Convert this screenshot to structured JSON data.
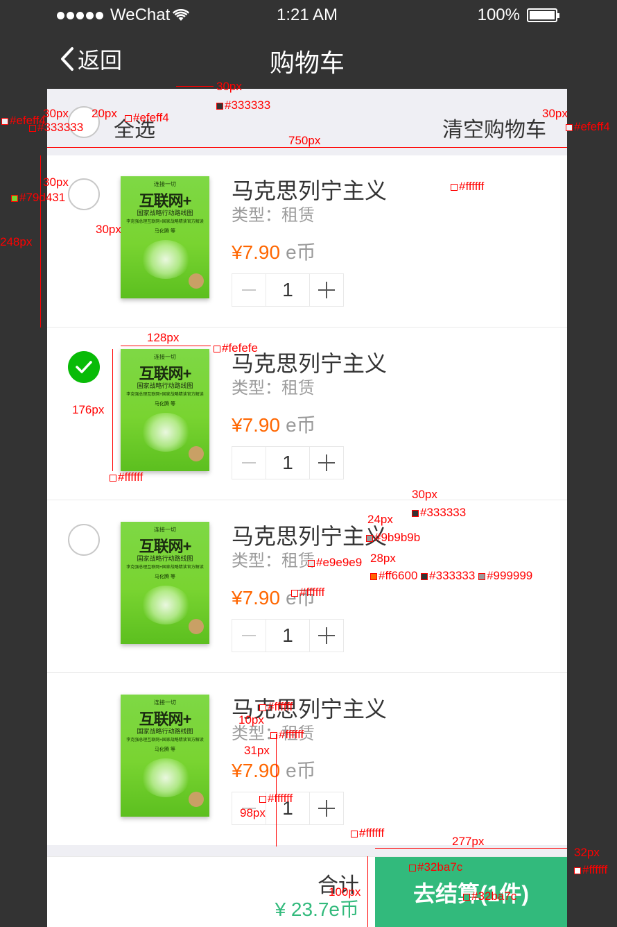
{
  "status_bar": {
    "carrier": "WeChat",
    "time": "1:21 AM",
    "battery": "100%"
  },
  "nav": {
    "back_label": "返回",
    "title": "购物车"
  },
  "select_bar": {
    "select_all_label": "全选",
    "clear_label": "清空购物车"
  },
  "items": [
    {
      "name": "马克思列宁主义",
      "type_label": "类型：租赁",
      "price": "¥7.90",
      "unit": "e币",
      "quantity": "1",
      "selected": false,
      "cover": {
        "small": "连接一切",
        "title": "互联网+",
        "subtitle": "国家战略行动路线图",
        "line": "李克强总理互联网+国家战略精读官方解读",
        "author": "马化腾 等"
      }
    },
    {
      "name": "马克思列宁主义",
      "type_label": "类型：租赁",
      "price": "¥7.90",
      "unit": "e币",
      "quantity": "1",
      "selected": true,
      "cover": {
        "small": "连接一切",
        "title": "互联网+",
        "subtitle": "国家战略行动路线图",
        "line": "李克强总理互联网+国家战略精读官方解读",
        "author": "马化腾 等"
      }
    },
    {
      "name": "马克思列宁主义",
      "type_label": "类型：租赁",
      "price": "¥7.90",
      "unit": "e币",
      "quantity": "1",
      "selected": false,
      "cover": {
        "small": "连接一切",
        "title": "互联网+",
        "subtitle": "国家战略行动路线图",
        "line": "李克强总理互联网+国家战略精读官方解读",
        "author": "马化腾 等"
      }
    },
    {
      "name": "马克思列宁主义",
      "type_label": "类型：租赁",
      "price": "¥7.90",
      "unit": "e币",
      "quantity": "1",
      "selected": null,
      "cover": {
        "small": "连接一切",
        "title": "互联网+",
        "subtitle": "国家战略行动路线图",
        "line": "李克强总理互联网+国家战略精读官方解读",
        "author": "马化腾 等"
      }
    }
  ],
  "footer": {
    "total_label": "合计",
    "total_value": "¥ 23.7e币",
    "checkout_label": "去结算(1件)"
  },
  "colors": {
    "nav_bg": "#333333",
    "page_gray": "#efeff4",
    "price": "#ff6600",
    "accent_green": "#32ba7c",
    "check_green": "#09bb07",
    "divider": "#e9e9e9",
    "type_text": "#9b9b9b",
    "unit_text": "#999999",
    "cover_green": "#79d431"
  },
  "annotations": [
    "30px",
    "#333333",
    "30px",
    "20px",
    "#efeff4",
    "#efeff4",
    "#333333",
    "30px",
    "#efeff4",
    "750px",
    "30px",
    "#ffffff",
    "#79d431",
    "#ffffff",
    "30px",
    "248px",
    "128px",
    "#fefefe",
    "176px",
    "#ffffff",
    "30px",
    "#333333",
    "24px",
    "#ffffff",
    "#9b9b9b",
    "#e9e9e9",
    "28px",
    "#ff6600",
    "#333333",
    "#999999",
    "#ffffff",
    "#ffffff",
    "10px",
    "#ffffff",
    "31px",
    "#ffffff",
    "98px",
    "#ffffff",
    "277px",
    "32px",
    "#ffffff",
    "#32ba7c",
    "100px",
    "#32ba7c"
  ]
}
